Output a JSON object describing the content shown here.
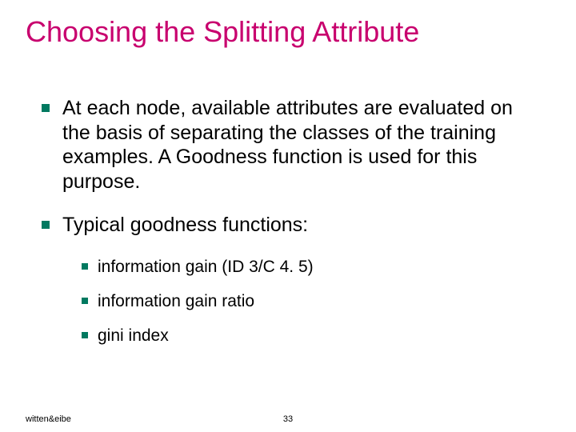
{
  "slide": {
    "title": "Choosing the Splitting Attribute",
    "bullets": [
      {
        "text": "At each node, available attributes are evaluated on the basis of separating the classes of the training examples. A Goodness function is used for this purpose."
      },
      {
        "text": "Typical goodness functions:",
        "sub": [
          "information gain (ID 3/C 4. 5)",
          "information gain ratio",
          "gini index"
        ]
      }
    ],
    "footer": {
      "author": "witten&eibe",
      "page": "33"
    }
  }
}
